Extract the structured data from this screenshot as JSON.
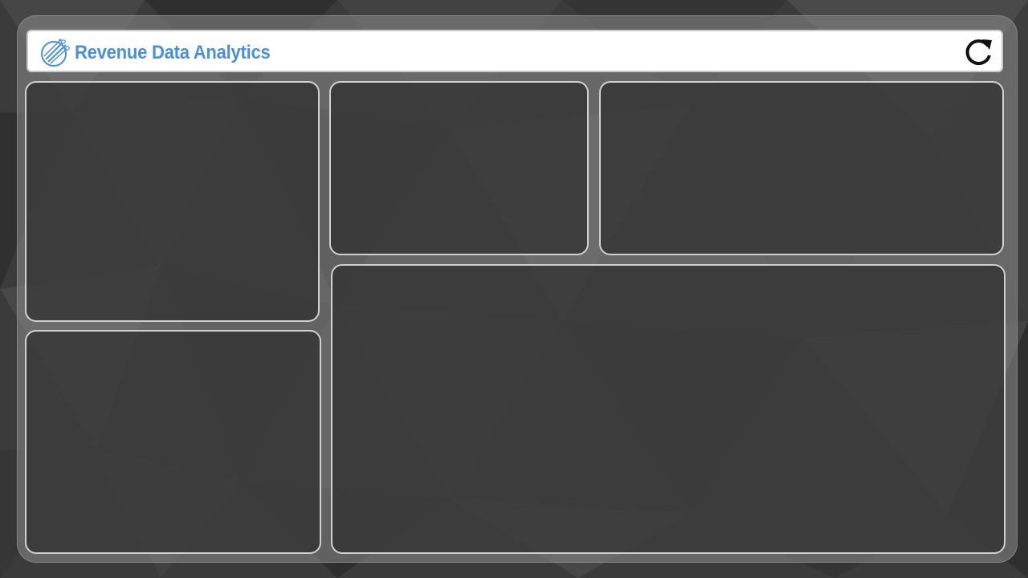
{
  "header": {
    "title": "Revenue Data Analytics",
    "logo_icon": "analytics-logo-icon",
    "refresh_icon": "refresh-icon"
  },
  "colors": {
    "title": "#4a90d9",
    "header_bg": "#ffffff",
    "panel_border": "#d0d0d0",
    "panel_bg": "#2d2d2d",
    "background": "#3a3a3a"
  },
  "panels": [
    {
      "id": "panel-top-left"
    },
    {
      "id": "panel-top-middle"
    },
    {
      "id": "panel-top-right"
    },
    {
      "id": "panel-bottom-left"
    },
    {
      "id": "panel-bottom-right"
    }
  ]
}
